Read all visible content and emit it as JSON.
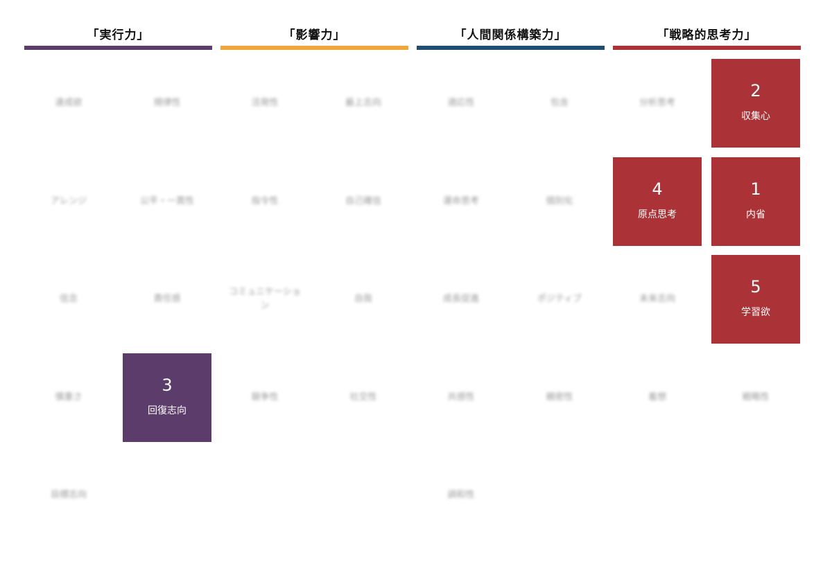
{
  "domains": [
    {
      "title": "「実行力」",
      "color": "#5b3c6b",
      "cells": [
        {
          "label": "達成欲",
          "rank": null
        },
        {
          "label": "規律性",
          "rank": null
        },
        {
          "label": "アレンジ",
          "rank": null
        },
        {
          "label": "公平・一貫性",
          "rank": null
        },
        {
          "label": "信念",
          "rank": null
        },
        {
          "label": "責任感",
          "rank": null
        },
        {
          "label": "慎重さ",
          "rank": null
        },
        {
          "label": "回復志向",
          "rank": "3"
        },
        {
          "label": "目標志向",
          "rank": null
        }
      ]
    },
    {
      "title": "「影響力」",
      "color": "#f0a63a",
      "cells": [
        {
          "label": "活発性",
          "rank": null
        },
        {
          "label": "最上志向",
          "rank": null
        },
        {
          "label": "指令性",
          "rank": null
        },
        {
          "label": "自己確信",
          "rank": null
        },
        {
          "label": "コミュニケーション",
          "rank": null
        },
        {
          "label": "自我",
          "rank": null
        },
        {
          "label": "競争性",
          "rank": null
        },
        {
          "label": "社交性",
          "rank": null
        }
      ]
    },
    {
      "title": "「人間関係構築力」",
      "color": "#1f4e6e",
      "cells": [
        {
          "label": "適応性",
          "rank": null
        },
        {
          "label": "包含",
          "rank": null
        },
        {
          "label": "運命思考",
          "rank": null
        },
        {
          "label": "個別化",
          "rank": null
        },
        {
          "label": "成長促進",
          "rank": null
        },
        {
          "label": "ポジティブ",
          "rank": null
        },
        {
          "label": "共感性",
          "rank": null
        },
        {
          "label": "親密性",
          "rank": null
        },
        {
          "label": "調和性",
          "rank": null
        }
      ]
    },
    {
      "title": "「戦略的思考力」",
      "color": "#ab3236",
      "cells": [
        {
          "label": "分析思考",
          "rank": null
        },
        {
          "label": "収集心",
          "rank": "2"
        },
        {
          "label": "原点思考",
          "rank": "4"
        },
        {
          "label": "内省",
          "rank": "1"
        },
        {
          "label": "未来志向",
          "rank": null
        },
        {
          "label": "学習欲",
          "rank": "5"
        },
        {
          "label": "着想",
          "rank": null
        },
        {
          "label": "戦略性",
          "rank": null
        }
      ]
    }
  ]
}
